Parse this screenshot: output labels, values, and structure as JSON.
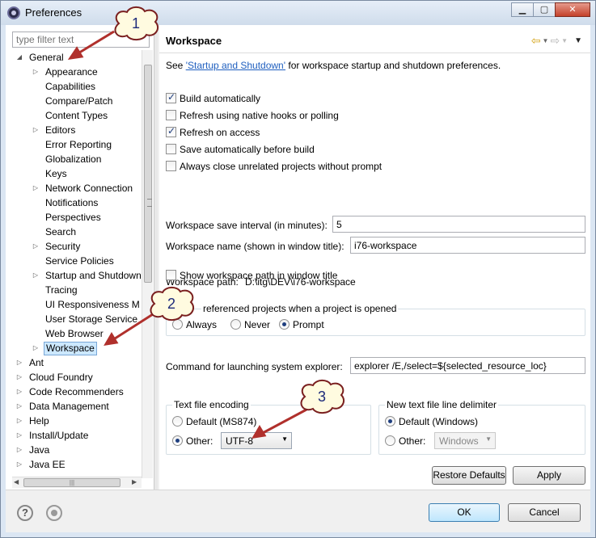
{
  "window": {
    "title": "Preferences",
    "min_glyph": "▁",
    "max_glyph": "▢",
    "close_glyph": "✕"
  },
  "filter": {
    "placeholder": "type filter text"
  },
  "tree": {
    "items": [
      {
        "label": "General",
        "level": 0,
        "twisty": "◢"
      },
      {
        "label": "Appearance",
        "level": 1,
        "twisty": "▷"
      },
      {
        "label": "Capabilities",
        "level": 1,
        "twisty": ""
      },
      {
        "label": "Compare/Patch",
        "level": 1,
        "twisty": ""
      },
      {
        "label": "Content Types",
        "level": 1,
        "twisty": ""
      },
      {
        "label": "Editors",
        "level": 1,
        "twisty": "▷"
      },
      {
        "label": "Error Reporting",
        "level": 1,
        "twisty": ""
      },
      {
        "label": "Globalization",
        "level": 1,
        "twisty": ""
      },
      {
        "label": "Keys",
        "level": 1,
        "twisty": ""
      },
      {
        "label": "Network Connection",
        "level": 1,
        "twisty": "▷"
      },
      {
        "label": "Notifications",
        "level": 1,
        "twisty": ""
      },
      {
        "label": "Perspectives",
        "level": 1,
        "twisty": ""
      },
      {
        "label": "Search",
        "level": 1,
        "twisty": ""
      },
      {
        "label": "Security",
        "level": 1,
        "twisty": "▷"
      },
      {
        "label": "Service Policies",
        "level": 1,
        "twisty": ""
      },
      {
        "label": "Startup and Shutdown",
        "level": 1,
        "twisty": "▷"
      },
      {
        "label": "Tracing",
        "level": 1,
        "twisty": ""
      },
      {
        "label": "UI Responsiveness M",
        "level": 1,
        "twisty": ""
      },
      {
        "label": "User Storage Service",
        "level": 1,
        "twisty": ""
      },
      {
        "label": "Web Browser",
        "level": 1,
        "twisty": ""
      },
      {
        "label": "Workspace",
        "level": 1,
        "twisty": "▷",
        "selected": true
      },
      {
        "label": "Ant",
        "level": 0,
        "twisty": "▷"
      },
      {
        "label": "Cloud Foundry",
        "level": 0,
        "twisty": "▷"
      },
      {
        "label": "Code Recommenders",
        "level": 0,
        "twisty": "▷"
      },
      {
        "label": "Data Management",
        "level": 0,
        "twisty": "▷"
      },
      {
        "label": "Help",
        "level": 0,
        "twisty": "▷"
      },
      {
        "label": "Install/Update",
        "level": 0,
        "twisty": "▷"
      },
      {
        "label": "Java",
        "level": 0,
        "twisty": "▷"
      },
      {
        "label": "Java EE",
        "level": 0,
        "twisty": "▷"
      }
    ],
    "hscroll_left": "◀",
    "hscroll_right": "▶",
    "hscroll_grip": "|||"
  },
  "page": {
    "title": "Workspace",
    "nav_back": "⇦",
    "nav_fwd": "⇨",
    "nav_dropdown": "▼",
    "see_prefix": "See ",
    "see_link": "'Startup and Shutdown'",
    "see_suffix": " for workspace startup and shutdown preferences.",
    "checkboxes": [
      {
        "label": "Build automatically",
        "checked": true
      },
      {
        "label": "Refresh using native hooks or polling",
        "checked": false
      },
      {
        "label": "Refresh on access",
        "checked": true
      },
      {
        "label": "Save automatically before build",
        "checked": false
      },
      {
        "label": "Always close unrelated projects without prompt",
        "checked": false
      }
    ],
    "save_interval_label": "Workspace save interval (in minutes):",
    "save_interval_value": "5",
    "workspace_name_label": "Workspace name (shown in window title):",
    "workspace_name_value": "i76-workspace",
    "workspace_path_label": "Workspace path:",
    "workspace_path_value": "D:\\itg\\DEV\\i76-workspace",
    "show_path_label": "Show workspace path in window title",
    "open_ref_group_label": "referenced projects when a project is opened",
    "open_ref_options": [
      {
        "label": "Always",
        "selected": false
      },
      {
        "label": "Never",
        "selected": false
      },
      {
        "label": "Prompt",
        "selected": true
      }
    ],
    "explorer_label": "Command for launching system explorer:",
    "explorer_value": "explorer /E,/select=${selected_resource_loc}",
    "encoding_group_label": "Text file encoding",
    "encoding_default_label": "Default (MS874)",
    "encoding_other_label": "Other:",
    "encoding_other_value": "UTF-8",
    "delimiter_group_label": "New text file line delimiter",
    "delimiter_default_label": "Default (Windows)",
    "delimiter_other_label": "Other:",
    "delimiter_other_value": "Windows",
    "combo_arrow": "▼",
    "restore_defaults": "Restore Defaults",
    "apply": "Apply"
  },
  "bottom": {
    "help_glyph": "?",
    "ok": "OK",
    "cancel": "Cancel"
  },
  "callouts": {
    "one": "1",
    "two": "2",
    "three": "3"
  },
  "colors": {
    "callout_fill": "#fffbe0",
    "callout_stroke": "#7a1f1f",
    "arrow": "#b0302c",
    "selection": "#cce8ff"
  }
}
